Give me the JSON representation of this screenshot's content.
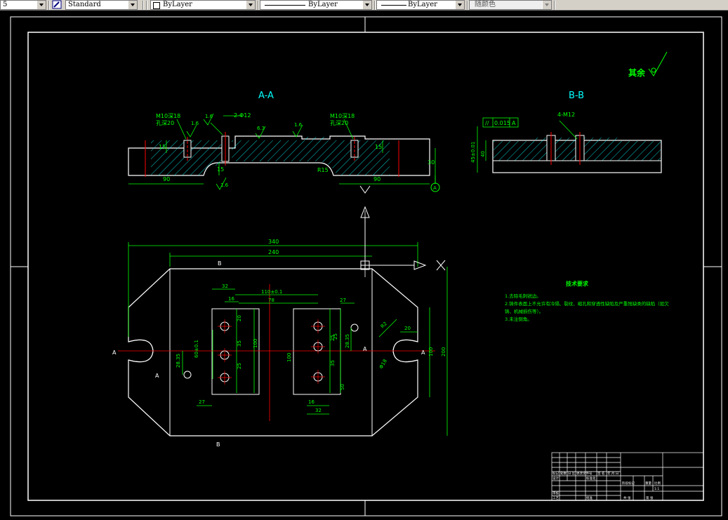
{
  "toolbar": {
    "layer_prefix": "5",
    "text_style": "Standard",
    "layer": "ByLayer",
    "linetype": "ByLayer",
    "lineweight": "ByLayer",
    "color": "随颜色"
  },
  "drawing": {
    "section_a_title": "A-A",
    "section_b_title": "B-B",
    "roughness_other": "其余",
    "roughness_values": [
      "1.6",
      "1.6",
      "6.3",
      "1.6",
      "1.6"
    ],
    "callout_m10_left": "M10深18",
    "callout_hole_left": "孔深20",
    "callout_m10_right": "M10深18",
    "callout_hole_right": "孔深20",
    "callout_2holes": "2-Φ12",
    "callout_4m12": "4-M12",
    "tolerance_frame": [
      "//",
      "0.015",
      "A"
    ],
    "datum_a": "A",
    "dims_section_a": [
      "90",
      "90",
      "30",
      "15",
      "15",
      "R15",
      "15"
    ],
    "dims_section_b": [
      "45±0.01",
      "40"
    ],
    "dims_plan_top": [
      "340",
      "240"
    ],
    "dims_plan_inner": [
      "32",
      "16",
      "110±0.1",
      "78",
      "27",
      "20",
      "35",
      "100",
      "25",
      "35",
      "25",
      "50",
      "16",
      "32",
      "27",
      "25",
      "28.35",
      "100",
      "60±0.1",
      "28.35",
      "Φ18",
      "20",
      "100",
      "200",
      "R2"
    ],
    "section_marks": [
      "A",
      "A",
      "A",
      "A",
      "B",
      "B"
    ],
    "tech_title": "技术要求",
    "tech_lines": [
      "1.去除毛刺锐边。",
      "2.铸件表面上不允许有冷隔、裂纹、缩孔和穿透性缺陷及严重残缺类的缺陷（如欠",
      "铸、机械损伤等）。",
      "3.未注倒角。"
    ],
    "title_block": {
      "row_a": [
        "标记",
        "处数",
        "分 区",
        "更改文件号",
        "签 名",
        "年.月.日"
      ],
      "row_b": [
        "设计",
        "",
        "",
        "标准化",
        "",
        "阶段标记",
        "重量",
        "比例"
      ],
      "row_c": [
        "审核"
      ],
      "row_d": [
        "工艺",
        "",
        "",
        "批准",
        "",
        "共  张",
        "第  张"
      ],
      "scale": "1:1"
    }
  }
}
